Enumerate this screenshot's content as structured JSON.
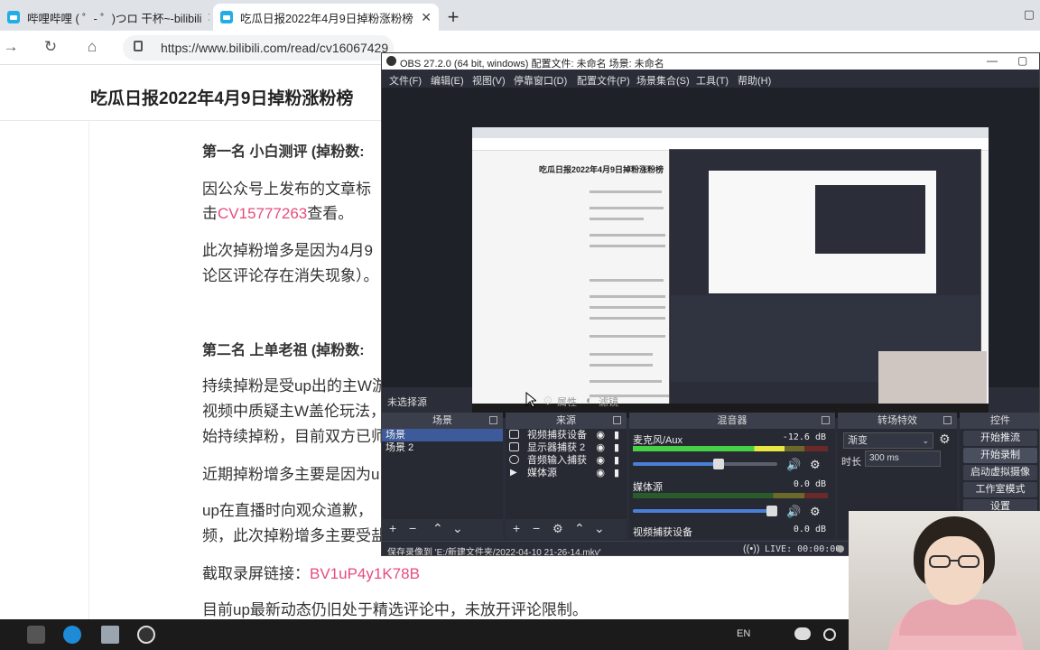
{
  "browser": {
    "tabs": [
      {
        "label": "哔哩哔哩 ( ゜- ゜)つロ 干杯~-bilibili",
        "active": false
      },
      {
        "label": "吃瓜日报2022年4月9日掉粉涨粉榜",
        "active": true
      }
    ],
    "url": "https://www.bilibili.com/read/cv16067429"
  },
  "article": {
    "title": "吃瓜日报2022年4月9日掉粉涨粉榜",
    "lines": [
      {
        "text": "第一名 小白测评 (掉粉数:",
        "kind": "heading"
      },
      {
        "text": "因公众号上发布的文章标",
        "kind": "text"
      },
      {
        "prefix": "击",
        "link": "CV15777263",
        "suffix": "查看。",
        "kind": "link-line"
      },
      {
        "text": "此次掉粉增多是因为4月9",
        "kind": "text"
      },
      {
        "text": "论区评论存在消失现象）。",
        "kind": "text"
      },
      {
        "text": "第二名 上单老祖 (掉粉数:",
        "kind": "heading"
      },
      {
        "text": "持续掉粉是受up出的主W游",
        "kind": "text"
      },
      {
        "text": "视频中质疑主W盖伦玩法，",
        "kind": "text"
      },
      {
        "text": "始持续掉粉，目前双方已师",
        "kind": "text"
      },
      {
        "text": "近期掉粉增多主要是因为u",
        "kind": "text"
      },
      {
        "text": "up在直播时向观众道歉，",
        "kind": "text"
      },
      {
        "text": "频，此次掉粉增多主要受盐",
        "kind": "text"
      },
      {
        "prefix": "截取录屏链接：",
        "link": "BV1uP4y1K78B",
        "suffix": "",
        "kind": "link-line"
      },
      {
        "text": "目前up最新动态仍旧处于精选评论中，未放开评论限制。",
        "kind": "text"
      }
    ]
  },
  "obs": {
    "title": "OBS 27.2.0 (64 bit, windows)  配置文件: 未命名  场景: 未命名",
    "menu": [
      "文件(F)",
      "编辑(E)",
      "视图(V)",
      "停靠窗口(D)",
      "配置文件(P)",
      "场景集合(S)",
      "工具(T)",
      "帮助(H)"
    ],
    "source_toolbar": {
      "no_source": "未选择源",
      "properties": "属性",
      "filters": "滤镜"
    },
    "panels": {
      "scenes": {
        "title": "场景",
        "items": [
          "场景",
          "场景 2"
        ]
      },
      "sources": {
        "title": "来源",
        "items": [
          "视频捕获设备",
          "显示器捕获 2",
          "音频输入捕获",
          "媒体源"
        ]
      },
      "mixer": {
        "title": "混音器",
        "tracks": [
          {
            "name": "麦克风/Aux",
            "db": "-12.6 dB",
            "level": 0.78,
            "volume": 0.6
          },
          {
            "name": "媒体源",
            "db": "0.0 dB",
            "level": 0.0,
            "volume": 1.0
          },
          {
            "name": "视频捕获设备",
            "db": "0.0 dB",
            "level": 0.0,
            "volume": 1.0
          }
        ]
      },
      "transitions": {
        "title": "转场特效",
        "selected": "渐变",
        "duration_label": "时长",
        "duration": "300 ms"
      },
      "controls": {
        "title": "控件",
        "buttons": [
          "开始推流",
          "开始录制",
          "启动虚拟摄像",
          "工作室模式",
          "设置"
        ]
      }
    },
    "status": {
      "saved": "保存录像到 'E:/新建文件夹/2022-04-10 21-26-14.mkv'",
      "live": "LIVE: 00:00:00"
    }
  },
  "taskbar": {
    "lang": "EN"
  }
}
